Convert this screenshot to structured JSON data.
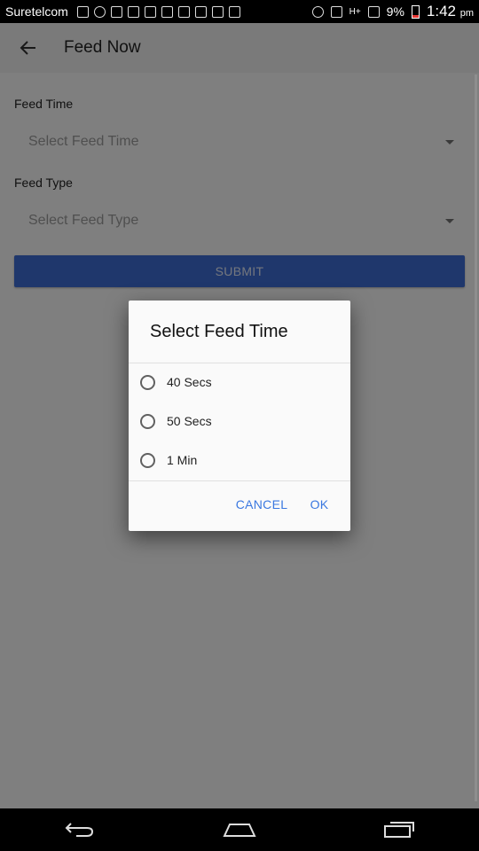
{
  "status_bar": {
    "carrier": "Suretelcom",
    "battery": "9%",
    "time": "1:42",
    "time_suffix": "pm",
    "signal_label": "H+"
  },
  "app_bar": {
    "title": "Feed Now"
  },
  "form": {
    "feed_time_label": "Feed Time",
    "feed_time_placeholder": "Select Feed Time",
    "feed_type_label": "Feed Type",
    "feed_type_placeholder": "Select Feed Type",
    "submit_label": "SUBMIT"
  },
  "dialog": {
    "title": "Select Feed Time",
    "options": [
      {
        "label": "40 Secs"
      },
      {
        "label": "50 Secs"
      },
      {
        "label": "1 Min"
      }
    ],
    "cancel_label": "CANCEL",
    "ok_label": "OK"
  }
}
